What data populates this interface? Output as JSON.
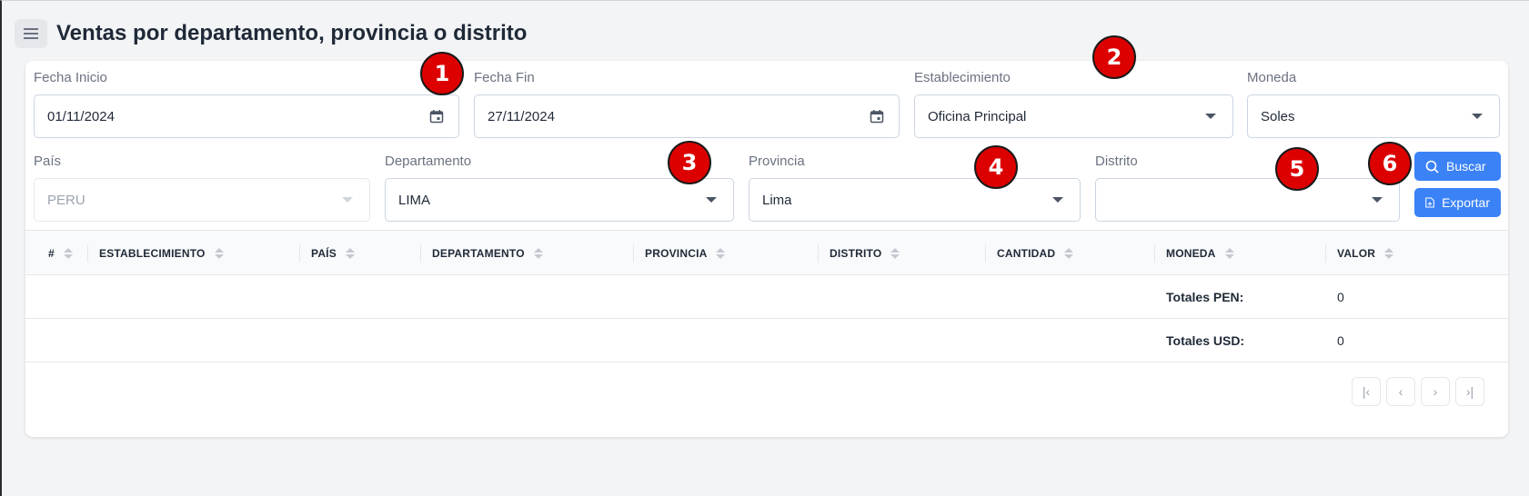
{
  "page": {
    "title": "Ventas por departamento, provincia o distrito"
  },
  "filters": {
    "fecha_inicio": {
      "label": "Fecha Inicio",
      "value": "01/11/2024"
    },
    "fecha_fin": {
      "label": "Fecha Fin",
      "value": "27/11/2024"
    },
    "establecimiento": {
      "label": "Establecimiento",
      "value": "Oficina Principal"
    },
    "moneda": {
      "label": "Moneda",
      "value": "Soles"
    },
    "pais": {
      "label": "País",
      "value": "PERU"
    },
    "departamento": {
      "label": "Departamento",
      "value": "LIMA"
    },
    "provincia": {
      "label": "Provincia",
      "value": "Lima"
    },
    "distrito": {
      "label": "Distrito",
      "value": ""
    }
  },
  "buttons": {
    "buscar": "Buscar",
    "exportar": "Exportar"
  },
  "table": {
    "columns": [
      "#",
      "ESTABLECIMIENTO",
      "PAÍS",
      "DEPARTAMENTO",
      "PROVINCIA",
      "DISTRITO",
      "CANTIDAD",
      "MONEDA",
      "VALOR"
    ],
    "totals": [
      {
        "label": "Totales PEN:",
        "value": "0"
      },
      {
        "label": "Totales USD:",
        "value": "0"
      }
    ]
  },
  "pagination": {
    "first": "|‹",
    "prev": "‹",
    "next": "›",
    "last": "›|"
  },
  "annotations": [
    "1",
    "2",
    "3",
    "4",
    "5",
    "6"
  ],
  "colors": {
    "primary": "#3b82f6",
    "badge": "#dc0000"
  }
}
